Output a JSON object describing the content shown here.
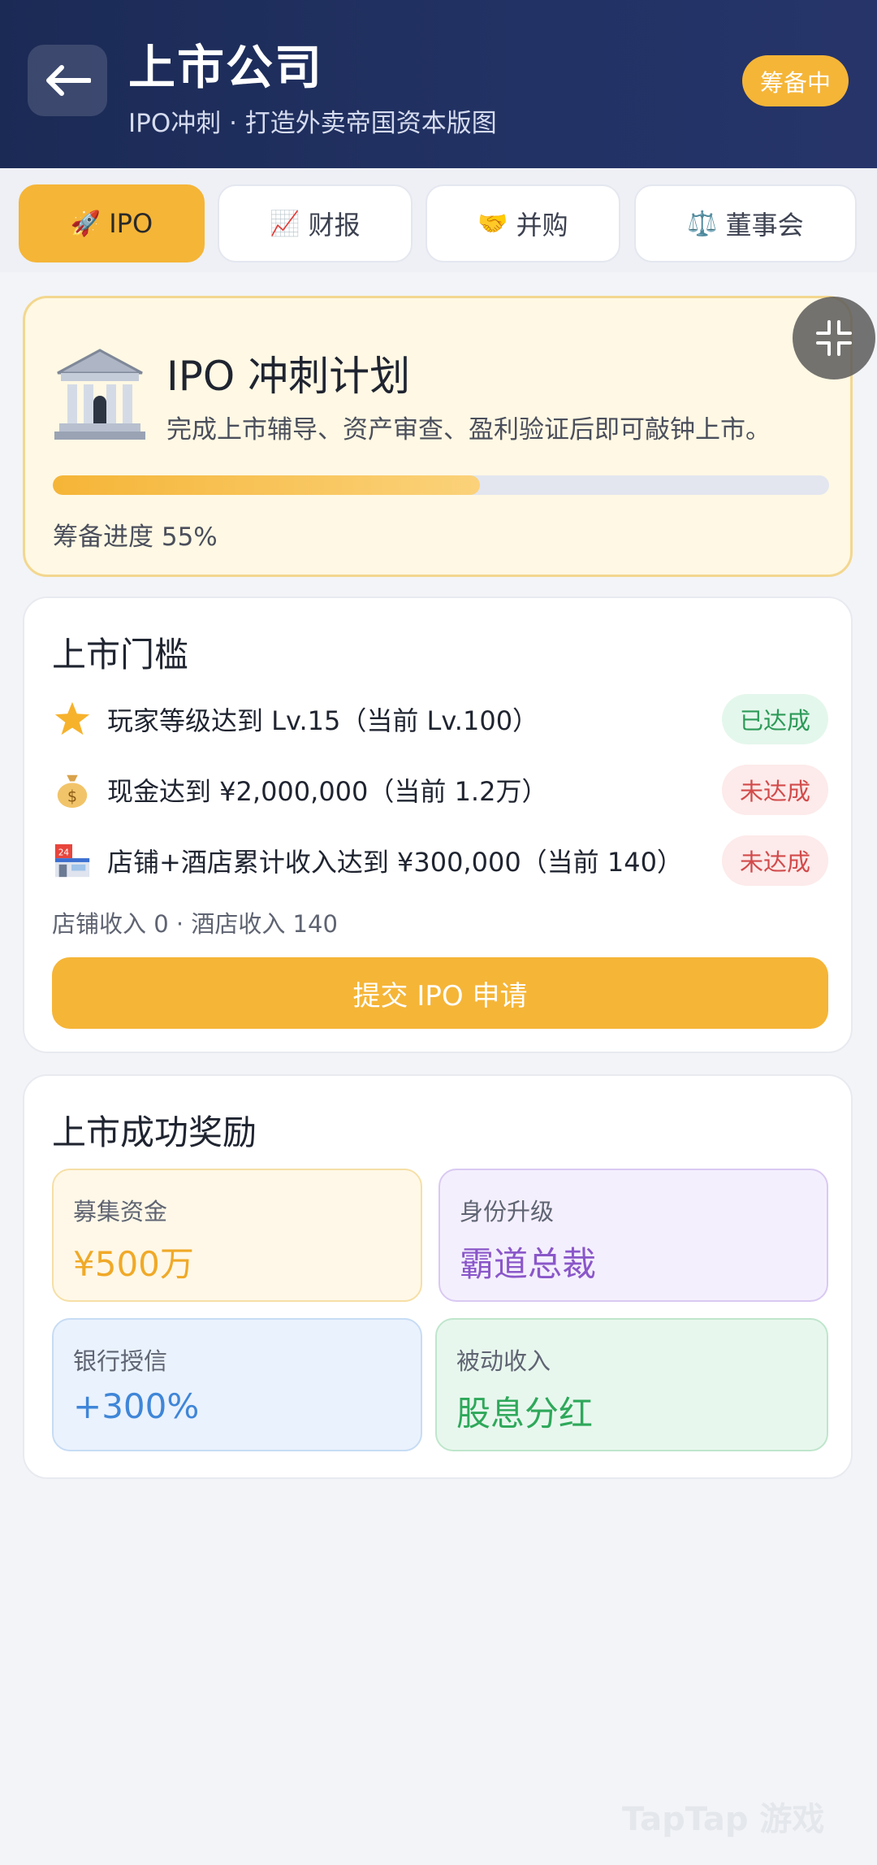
{
  "header": {
    "title": "上市公司",
    "subtitle": "IPO冲刺 · 打造外卖帝国资本版图",
    "status": "筹备中"
  },
  "tabs": [
    {
      "icon": "🚀",
      "label": "IPO",
      "active": true
    },
    {
      "icon": "📈",
      "label": "财报",
      "active": false
    },
    {
      "icon": "🤝",
      "label": "并购",
      "active": false
    },
    {
      "icon": "⚖️",
      "label": "董事会",
      "active": false
    }
  ],
  "plan": {
    "title": "IPO 冲刺计划",
    "description": "完成上市辅导、资产审查、盈利验证后即可敲钟上市。",
    "progress_label": "筹备进度 55%",
    "progress_fraction": 0.55
  },
  "threshold": {
    "title": "上市门槛",
    "requirements": [
      {
        "icon": "⭐",
        "text": "玩家等级达到 Lv.15（当前 Lv.100）",
        "status": "已达成"
      },
      {
        "icon": "💰",
        "text": "现金达到 ¥2,000,000（当前 1.2万）",
        "status": "未达成"
      },
      {
        "icon": "🏪",
        "text": "店铺+酒店累计收入达到 ¥300,000（当前 140）",
        "status": "未达成"
      }
    ],
    "income_note": "店铺收入 0 · 酒店收入 140",
    "submit_label": "提交 IPO 申请"
  },
  "rewards": {
    "title": "上市成功奖励",
    "items": [
      {
        "label": "募集资金",
        "value": "¥500万"
      },
      {
        "label": "身份升级",
        "value": "霸道总裁"
      },
      {
        "label": "银行授信",
        "value": "+300%"
      },
      {
        "label": "被动收入",
        "value": "股息分红"
      }
    ]
  },
  "watermark": "TapTap 游戏",
  "colors": {
    "header_bg": "#1b2a55",
    "accent": "#f5b537",
    "success": "#2c9a57",
    "danger": "#d24b4b",
    "purple": "#8a57c9",
    "blue": "#3f86d8",
    "green": "#2ea85a"
  }
}
